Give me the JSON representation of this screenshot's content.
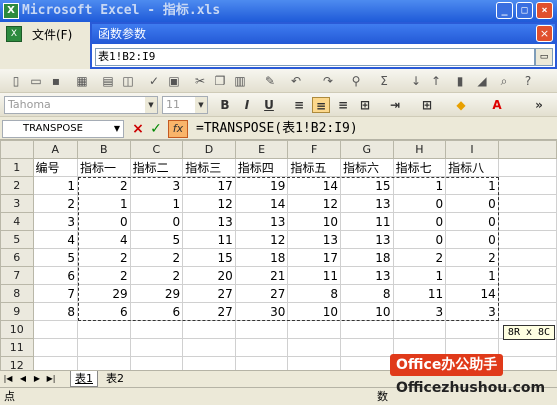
{
  "window": {
    "title": "Microsoft Excel - 指标.xls",
    "min_label": "_",
    "max_label": "□",
    "close_label": "×"
  },
  "menu": {
    "file": "文件(F)"
  },
  "dialog": {
    "title": "函数参数",
    "input_value": "表1!B2:I9",
    "close_label": "×"
  },
  "toolbar": {
    "font": "Tahoma",
    "size": "11",
    "bold": "B",
    "italic": "I",
    "underline": "U"
  },
  "formula_bar": {
    "name_box": "TRANSPOSE",
    "cancel": "×",
    "enter": "✓",
    "fx": "fx",
    "formula": "=TRANSPOSE(表1!B2:I9)"
  },
  "grid": {
    "columns": [
      "A",
      "B",
      "C",
      "D",
      "E",
      "F",
      "G",
      "H",
      "I"
    ],
    "rows": [
      [
        "编号",
        "指标一",
        "指标二",
        "指标三",
        "指标四",
        "指标五",
        "指标六",
        "指标七",
        "指标八"
      ],
      [
        "1",
        "2",
        "3",
        "17",
        "19",
        "14",
        "15",
        "1",
        "1"
      ],
      [
        "2",
        "1",
        "1",
        "12",
        "14",
        "12",
        "13",
        "0",
        "0"
      ],
      [
        "3",
        "0",
        "0",
        "13",
        "13",
        "10",
        "11",
        "0",
        "0"
      ],
      [
        "4",
        "4",
        "5",
        "11",
        "12",
        "13",
        "13",
        "0",
        "0"
      ],
      [
        "5",
        "2",
        "2",
        "15",
        "18",
        "17",
        "18",
        "2",
        "2"
      ],
      [
        "6",
        "2",
        "2",
        "20",
        "21",
        "11",
        "13",
        "1",
        "1"
      ],
      [
        "7",
        "29",
        "29",
        "27",
        "27",
        "8",
        "8",
        "11",
        "14"
      ],
      [
        "8",
        "6",
        "6",
        "27",
        "30",
        "10",
        "10",
        "3",
        "3"
      ],
      [
        "",
        "",
        "",
        "",
        "",
        "",
        "",
        "",
        ""
      ],
      [
        "",
        "",
        "",
        "",
        "",
        "",
        "",
        "",
        ""
      ],
      [
        "",
        "",
        "",
        "",
        "",
        "",
        "",
        "",
        ""
      ]
    ]
  },
  "sheets": {
    "tab1": "表1",
    "tab2": "表2"
  },
  "status": {
    "left": "点",
    "right": "数"
  },
  "tooltip": "8R x 8C",
  "watermark": {
    "badge": "Office办公助手",
    "site": "Officezhushou.com"
  }
}
